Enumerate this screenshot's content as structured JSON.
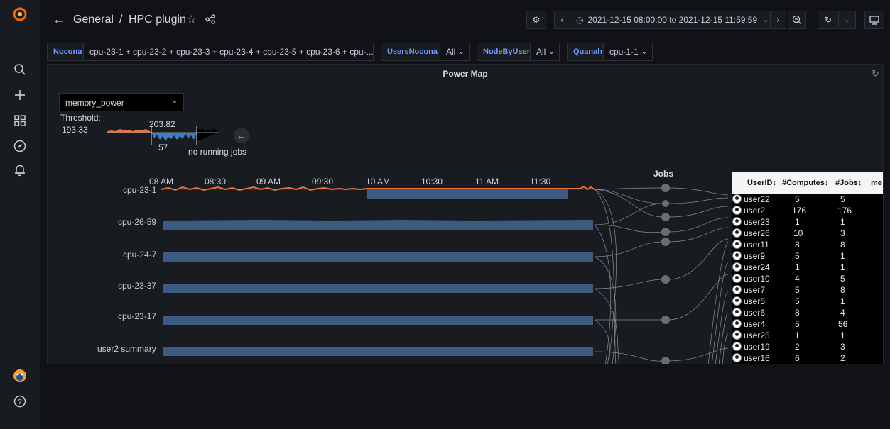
{
  "breadcrumb": {
    "folder": "General",
    "separator": "/",
    "dashboard": "HPC plugin"
  },
  "time_range": {
    "label": "2021-12-15 08:00:00 to 2021-12-15 11:59:59"
  },
  "variables": [
    {
      "label": "Nocona",
      "value": "cpu-23-1 + cpu-23-2 + cpu-23-3 + cpu-23-4 + cpu-23-5 + cpu-23-6 + cpu-..."
    },
    {
      "label": "UsersNocona",
      "value": "All"
    },
    {
      "label": "NodeByUser",
      "value": "All"
    },
    {
      "label": "Quanah",
      "value": "cpu-1-1"
    }
  ],
  "panel": {
    "title": "Power Map",
    "metric_select": "memory_power",
    "threshold_label": "Threshold:",
    "threshold_value": "193.33",
    "legend_max": "203.82",
    "legend_min": "57",
    "legend_note": "no running jobs",
    "jobs_label": "Jobs"
  },
  "timeline": {
    "ticks": [
      "08 AM",
      "08:30",
      "09 AM",
      "09:30",
      "10 AM",
      "10:30",
      "11 AM",
      "11:30"
    ],
    "rows": [
      "cpu-23-1",
      "cpu-26-59",
      "cpu-24-7",
      "cpu-23-37",
      "cpu-23-17",
      "user2 summary"
    ]
  },
  "table": {
    "headers": {
      "user": "UserID",
      "computes": "#Computes",
      "jobs": "#Jobs",
      "extra": "me"
    },
    "rows": [
      {
        "user": "user22",
        "computes": "5",
        "jobs": "5"
      },
      {
        "user": "user2",
        "computes": "176",
        "jobs": "176"
      },
      {
        "user": "user23",
        "computes": "1",
        "jobs": "1"
      },
      {
        "user": "user26",
        "computes": "10",
        "jobs": "3"
      },
      {
        "user": "user11",
        "computes": "8",
        "jobs": "8"
      },
      {
        "user": "user9",
        "computes": "5",
        "jobs": "1"
      },
      {
        "user": "user24",
        "computes": "1",
        "jobs": "1"
      },
      {
        "user": "user10",
        "computes": "4",
        "jobs": "5"
      },
      {
        "user": "user7",
        "computes": "5",
        "jobs": "8"
      },
      {
        "user": "user5",
        "computes": "5",
        "jobs": "1"
      },
      {
        "user": "user6",
        "computes": "8",
        "jobs": "4"
      },
      {
        "user": "user4",
        "computes": "5",
        "jobs": "56"
      },
      {
        "user": "user25",
        "computes": "1",
        "jobs": "1"
      },
      {
        "user": "user19",
        "computes": "2",
        "jobs": "3"
      },
      {
        "user": "user16",
        "computes": "6",
        "jobs": "2"
      }
    ]
  },
  "colors": {
    "accent_blue": "#6e9fff",
    "bar_blue": "#3d5b80",
    "power_orange": "#e8743b",
    "logo_orange": "#f46800"
  }
}
